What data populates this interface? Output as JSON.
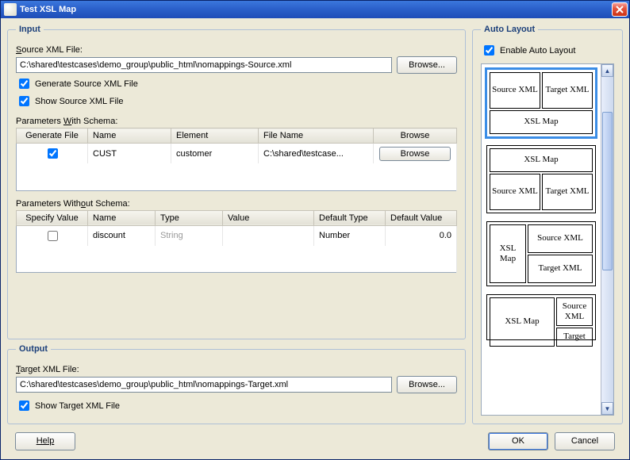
{
  "title": "Test XSL Map",
  "input": {
    "legend": "Input",
    "source_label_pre": "S",
    "source_label_rest": "ource XML File:",
    "source_value": "C:\\shared\\testcases\\demo_group\\public_html\\nomappings-Source.xml",
    "browse_label": "Browse...",
    "generate_checked": true,
    "generate_label_pre": "G",
    "generate_label_rest": "enerate Source XML File",
    "show_checked": true,
    "show_label_pre": "Sho",
    "show_label_mn": "w",
    "show_label_rest": " Source XML File",
    "params_with_label_pre": "Parameters ",
    "params_with_mn": "W",
    "params_with_rest": "ith Schema:",
    "params_with_headers": [
      "Generate File",
      "Name",
      "Element",
      "File Name",
      "Browse"
    ],
    "params_with_row": {
      "generate_checked": true,
      "name": "CUST",
      "element": "customer",
      "filename": "C:\\shared\\testcase...",
      "browse_btn": "Browse"
    },
    "params_without_label_pre": "Parameters With",
    "params_without_mn": "o",
    "params_without_rest": "ut Schema:",
    "params_without_headers": [
      "Specify Value",
      "Name",
      "Type",
      "Value",
      "Default Type",
      "Default Value"
    ],
    "params_without_row": {
      "specify_checked": false,
      "name": "discount",
      "type": "String",
      "value": "",
      "default_type": "Number",
      "default_value": "0.0"
    }
  },
  "output": {
    "legend": "Output",
    "target_label_pre": "T",
    "target_label_rest": "arget XML File:",
    "target_value": "C:\\shared\\testcases\\demo_group\\public_html\\nomappings-Target.xml",
    "browse_label": "Browse...",
    "show_checked": true,
    "show_label_pre": "Sh",
    "show_label_mn": "o",
    "show_label_rest": "w Target XML File"
  },
  "autolayout": {
    "legend": "Auto Layout",
    "enable_checked": true,
    "enable_label_pre": "E",
    "enable_label_rest": "nable Auto Layout",
    "cells": {
      "source_xml": "Source XML",
      "target_xml": "Target XML",
      "xsl_map": "XSL Map",
      "source": "Source",
      "target": "Target"
    }
  },
  "footer": {
    "help": "Help",
    "ok": "OK",
    "cancel": "Cancel"
  }
}
